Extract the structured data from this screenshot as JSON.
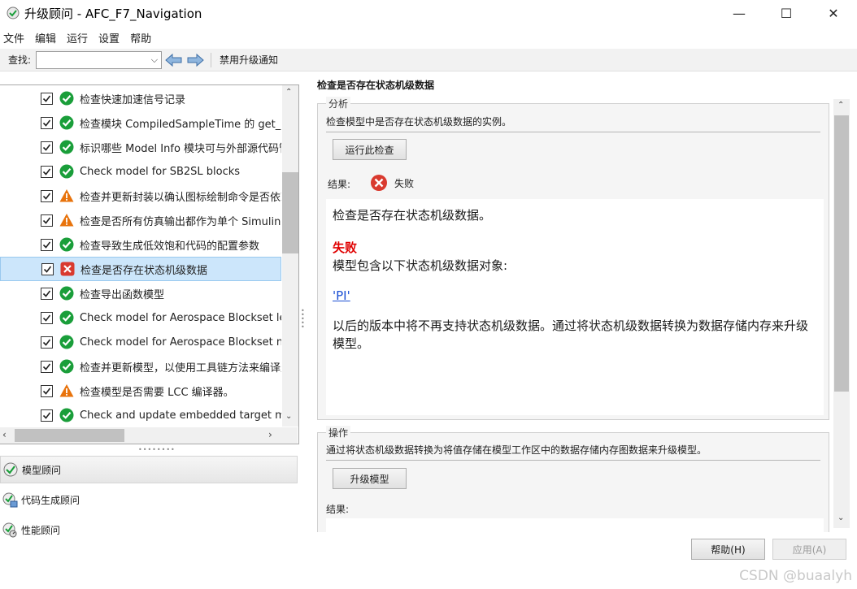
{
  "window": {
    "title": "升级顾问 - AFC_F7_Navigation",
    "minimize": "—",
    "maximize": "☐",
    "close": "✕"
  },
  "menu": [
    "文件",
    "编辑",
    "运行",
    "设置",
    "帮助"
  ],
  "toolbar": {
    "find_label": "查找:",
    "find_value": "",
    "disable_notify": "禁用升级通知"
  },
  "tree": {
    "rows": [
      {
        "label": "检查快速加速信号记录",
        "status": "pass",
        "checked": true,
        "selected": false
      },
      {
        "label": "检查模块 CompiledSampleTime 的 get_param",
        "status": "pass",
        "checked": true,
        "selected": false
      },
      {
        "label": "标识哪些 Model Info 模块可与外部源代码管理",
        "status": "pass",
        "checked": true,
        "selected": false
      },
      {
        "label": "Check model for SB2SL blocks",
        "status": "pass",
        "checked": true,
        "selected": false
      },
      {
        "label": "检查并更新封装以确认图标绘制命令是否依赖",
        "status": "warning",
        "checked": true,
        "selected": false
      },
      {
        "label": "检查是否所有仿真输出都作为单个 Simulink",
        "status": "warning",
        "checked": true,
        "selected": false
      },
      {
        "label": "检查导致生成低效饱和代码的配置参数",
        "status": "pass",
        "checked": true,
        "selected": false
      },
      {
        "label": "检查是否存在状态机级数据",
        "status": "fail",
        "checked": true,
        "selected": true
      },
      {
        "label": "检查导出函数模型",
        "status": "pass",
        "checked": true,
        "selected": false
      },
      {
        "label": "Check model for Aerospace Blockset legacy",
        "status": "pass",
        "checked": true,
        "selected": false
      },
      {
        "label": "Check model for Aerospace Blockset navigation",
        "status": "pass",
        "checked": true,
        "selected": false
      },
      {
        "label": "检查并更新模型，以使用工具链方法来编译生成",
        "status": "pass",
        "checked": true,
        "selected": false
      },
      {
        "label": "检查模型是否需要 LCC 编译器。",
        "status": "warning",
        "checked": true,
        "selected": false
      },
      {
        "label": "Check and update embedded target model",
        "status": "pass",
        "checked": true,
        "selected": false
      }
    ]
  },
  "advisors": [
    {
      "label": "模型顾问",
      "icon": "model-advisor-icon",
      "active": true
    },
    {
      "label": "代码生成顾问",
      "icon": "code-gen-advisor-icon",
      "active": false
    },
    {
      "label": "性能顾问",
      "icon": "performance-advisor-icon",
      "active": false
    }
  ],
  "right": {
    "title": "检查是否存在状态机级数据",
    "analysis": {
      "legend": "分析",
      "description": "检查模型中是否存在状态机级数据的实例。",
      "run_button": "运行此检查",
      "result_label": "结果:",
      "result_value": "失败",
      "report": {
        "heading": "检查是否存在状态机级数据。",
        "status": "失败",
        "line": "模型包含以下状态机级数据对象:",
        "link": "'PI'",
        "message": "以后的版本中将不再支持状态机级数据。通过将状态机级数据转换为数据存储内存来升级模型。"
      }
    },
    "action": {
      "legend": "操作",
      "description": "通过将状态机级数据转换为将值存储在模型工作区中的数据存储内存图数据来升级模型。",
      "upgrade_button": "升级模型",
      "result_label": "结果:"
    }
  },
  "footer": {
    "help_button": "帮助(H)",
    "apply_button": "应用(A)"
  },
  "watermark": "CSDN @buaalyh",
  "colors": {
    "pass": "#1a9e3a",
    "warning": "#e8730c",
    "fail": "#d93a2f",
    "fail_text": "#e00000",
    "link": "#1a4fd4",
    "selected_row": "#cce6fb"
  }
}
